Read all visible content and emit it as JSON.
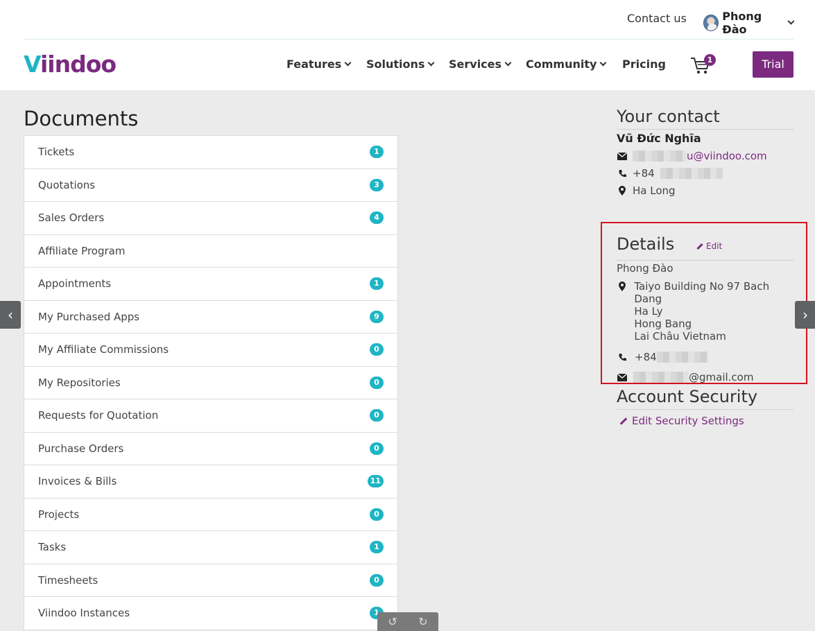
{
  "header": {
    "contact_us": "Contact us",
    "user_name": "Phong Đào",
    "logo": {
      "first": "V",
      "rest": "iindoo"
    },
    "nav": [
      {
        "label": "Features",
        "dropdown": true
      },
      {
        "label": "Solutions",
        "dropdown": true
      },
      {
        "label": "Services",
        "dropdown": true
      },
      {
        "label": "Community",
        "dropdown": true
      },
      {
        "label": "Pricing",
        "dropdown": false
      }
    ],
    "cart_count": "1",
    "trial_label": "Trial"
  },
  "documents": {
    "title": "Documents",
    "items": [
      {
        "label": "Tickets",
        "count": "1"
      },
      {
        "label": "Quotations",
        "count": "3"
      },
      {
        "label": "Sales Orders",
        "count": "4"
      },
      {
        "label": "Affiliate Program",
        "count": ""
      },
      {
        "label": "Appointments",
        "count": "1"
      },
      {
        "label": "My Purchased Apps",
        "count": "9"
      },
      {
        "label": "My Affiliate Commissions",
        "count": "0"
      },
      {
        "label": "My Repositories",
        "count": "0"
      },
      {
        "label": "Requests for Quotation",
        "count": "0"
      },
      {
        "label": "Purchase Orders",
        "count": "0"
      },
      {
        "label": "Invoices & Bills",
        "count": "11"
      },
      {
        "label": "Projects",
        "count": "0"
      },
      {
        "label": "Tasks",
        "count": "1"
      },
      {
        "label": "Timesheets",
        "count": "0"
      },
      {
        "label": "Viindoo Instances",
        "count": "1"
      }
    ]
  },
  "your_contact": {
    "title": "Your contact",
    "name": "Vũ Đức Nghĩa",
    "email_suffix": "u@viindoo.com",
    "phone_prefix": "+84",
    "location": "Ha Long"
  },
  "details": {
    "title": "Details",
    "edit_label": "Edit",
    "name": "Phong Đào",
    "address_lines": [
      "Taiyo Building No 97 Bach Dang",
      "Ha Ly",
      "Hong Bang",
      "Lai Châu Vietnam"
    ],
    "phone_prefix": "+84",
    "email_suffix": "@gmail.com"
  },
  "account_security": {
    "title": "Account Security",
    "edit_label": "Edit Security Settings"
  },
  "colors": {
    "brand_purple": "#7b2a7f",
    "brand_teal": "#1fb5c4",
    "highlight_red": "#d4121e"
  }
}
